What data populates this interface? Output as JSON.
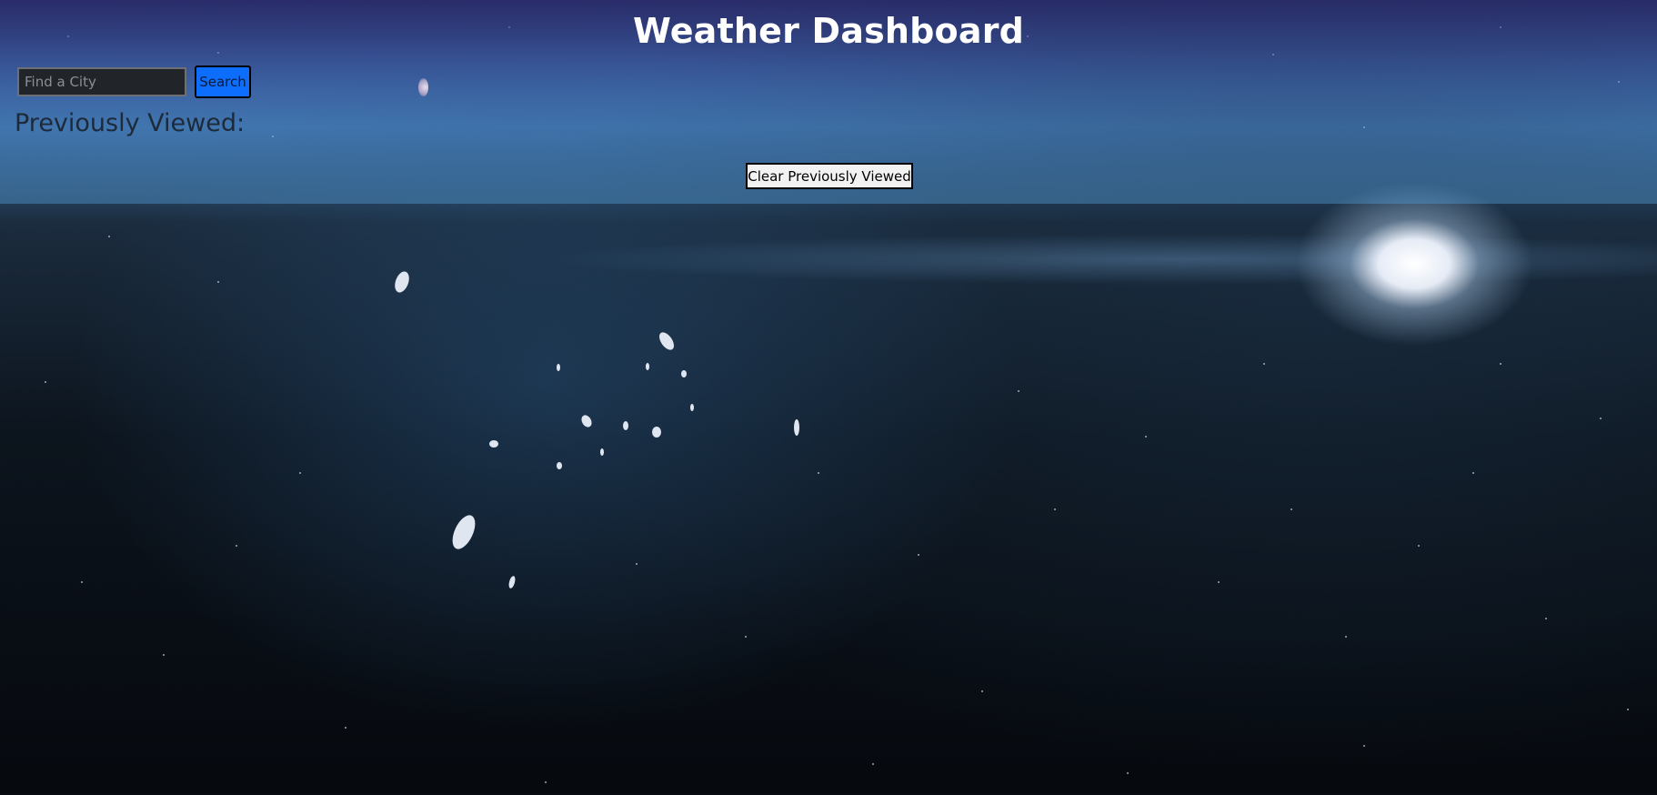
{
  "header": {
    "title": "Weather Dashboard"
  },
  "search": {
    "placeholder": "Find a City",
    "value": "",
    "button_label": "Search"
  },
  "history": {
    "heading": "Previously Viewed:",
    "items": [],
    "clear_label": "Clear Previously Viewed"
  },
  "colors": {
    "search_button": "#0d6efd",
    "input_background": "#212529"
  }
}
